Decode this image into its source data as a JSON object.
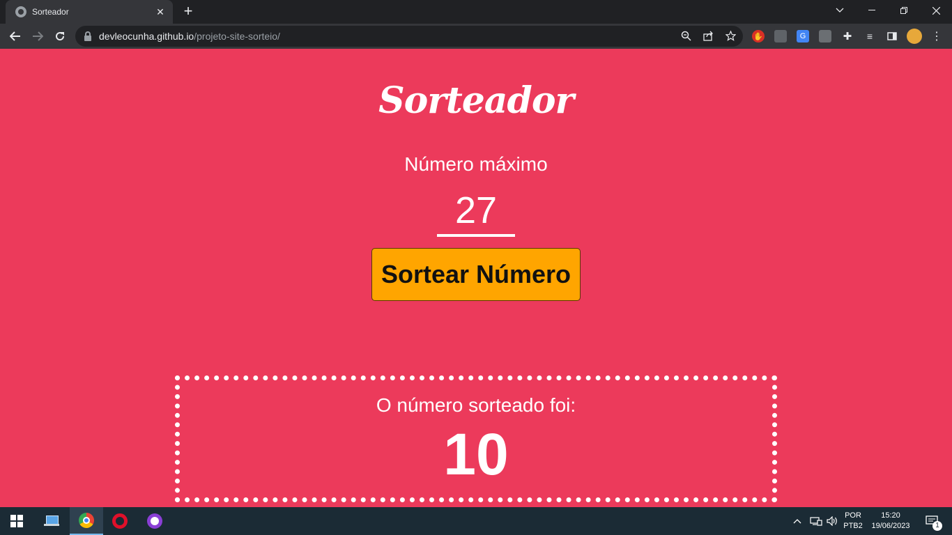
{
  "browser": {
    "tab_title": "Sorteador",
    "tab_close": "✕",
    "new_tab": "+",
    "url_host": "devleocunha.github.io",
    "url_path": "/projeto-site-sorteio/"
  },
  "page": {
    "logo": "Sorteador",
    "max_label": "Número máximo",
    "max_value": "27",
    "button_label": "Sortear Número",
    "result_label": "O número sorteado foi:",
    "result_value": "10",
    "background_color": "#ec3a5b",
    "button_color": "#ffa500"
  },
  "taskbar": {
    "language": "POR",
    "keyboard": "PTB2",
    "time": "15:20",
    "date": "19/06/2023",
    "notification_count": "1"
  }
}
